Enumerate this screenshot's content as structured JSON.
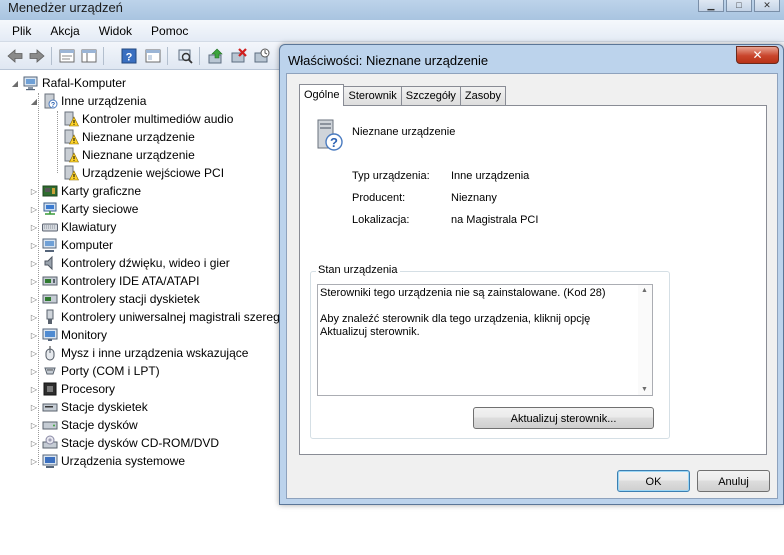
{
  "main_window": {
    "title": "Menedżer urządzeń",
    "menu": [
      "Plik",
      "Akcja",
      "Widok",
      "Pomoc"
    ],
    "toolbar_icons": [
      "back-arrow-icon",
      "forward-arrow-icon",
      "properties-icon",
      "show-hide-tree-icon",
      "help-icon",
      "view-icon",
      "scan-hardware-icon",
      "update-driver-icon",
      "disable-device-icon",
      "uninstall-device-icon"
    ]
  },
  "tree": {
    "root": "Rafal-Komputer",
    "other_devices": {
      "label": "Inne urządzenia",
      "children": [
        "Kontroler multimediów audio",
        "Nieznane urządzenie",
        "Nieznane urządzenie",
        "Urządzenie wejściowe PCI"
      ]
    },
    "categories": [
      "Karty graficzne",
      "Karty sieciowe",
      "Klawiatury",
      "Komputer",
      "Kontrolery dźwięku, wideo i gier",
      "Kontrolery IDE ATA/ATAPI",
      "Kontrolery stacji dyskietek",
      "Kontrolery uniwersalnej magistrali szeregowej",
      "Monitory",
      "Mysz i inne urządzenia wskazujące",
      "Porty (COM i LPT)",
      "Procesory",
      "Stacje dyskietek",
      "Stacje dysków",
      "Stacje dysków CD-ROM/DVD",
      "Urządzenia systemowe"
    ]
  },
  "dialog": {
    "title": "Właściwości: Nieznane urządzenie",
    "close_label": "✕",
    "tabs": [
      "Ogólne",
      "Sterownik",
      "Szczegóły",
      "Zasoby"
    ],
    "device_name": "Nieznane urządzenie",
    "properties": [
      {
        "label": "Typ urządzenia:",
        "value": "Inne urządzenia"
      },
      {
        "label": "Producent:",
        "value": "Nieznany"
      },
      {
        "label": "Lokalizacja:",
        "value": "na Magistrala PCI"
      }
    ],
    "status_group_label": "Stan urządzenia",
    "status_line1": "Sterowniki tego urządzenia nie są zainstalowane. (Kod 28)",
    "status_line2": "Aby znaleźć sterownik dla tego urządzenia, kliknij opcję Aktualizuj sterownik.",
    "update_button": "Aktualizuj sterownik...",
    "ok_button": "OK",
    "cancel_button": "Anuluj"
  }
}
